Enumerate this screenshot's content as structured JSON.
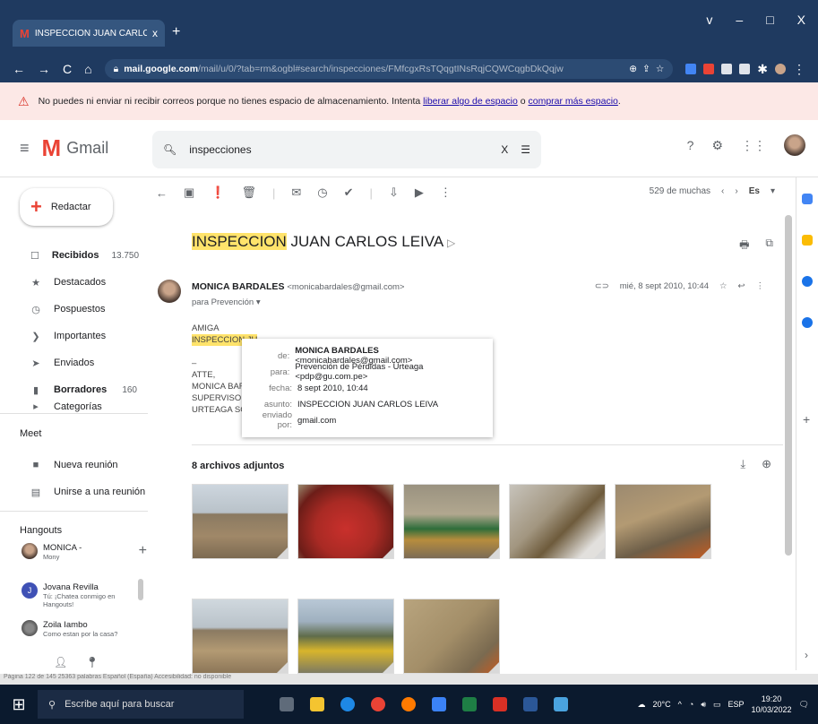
{
  "browser": {
    "tab_title": "INSPECCION JUAN CARLOS LEIV",
    "tab_close": "x",
    "new_tab": "+",
    "url_domain": "mail.google.com",
    "url_path": "/mail/u/0/?tab=rm&ogbl#search/inspecciones/FMfcgxRsTQqgtINsRqjCQWCqgbDkQqjw",
    "window_controls": [
      "v",
      "–",
      "□",
      "X"
    ]
  },
  "warning": {
    "text": "No puedes ni enviar ni recibir correos porque no tienes espacio de almacenamiento. Intenta ",
    "link1": "liberar algo de espacio",
    "mid": " o ",
    "link2": "comprar más espacio",
    "end": "."
  },
  "gmail": {
    "logo_text": "Gmail",
    "search_value": "inspecciones"
  },
  "sidebar": {
    "compose": "Redactar",
    "items": [
      {
        "label": "Recibidos",
        "count": "13.750",
        "icon": "inbox-icon",
        "bold": true
      },
      {
        "label": "Destacados",
        "count": "",
        "icon": "star-icon",
        "bold": false
      },
      {
        "label": "Pospuestos",
        "count": "",
        "icon": "clock-icon",
        "bold": false
      },
      {
        "label": "Importantes",
        "count": "",
        "icon": "important-icon",
        "bold": false
      },
      {
        "label": "Enviados",
        "count": "",
        "icon": "send-icon",
        "bold": false
      },
      {
        "label": "Borradores",
        "count": "160",
        "icon": "draft-icon",
        "bold": true
      },
      {
        "label": "Categorías",
        "count": "",
        "icon": "category-icon",
        "bold": false
      }
    ],
    "meet_title": "Meet",
    "meet_items": [
      "Nueva reunión",
      "Unirse a una reunión"
    ],
    "hangouts_title": "Hangouts",
    "contacts": [
      {
        "name": "MONICA -",
        "sub": "Mony"
      },
      {
        "name": "Jovana Revilla",
        "sub": "Tú: ¡Chatea conmigo en Hangouts!"
      },
      {
        "name": "Zoila Iambo",
        "sub": "Como estan por la casa?"
      }
    ]
  },
  "toolbar": {
    "pager": "529 de muchas",
    "lang": "Es"
  },
  "email": {
    "subject_hl": "INSPECCION",
    "subject_rest": " JUAN CARLOS LEIVA",
    "sender_name": "MONICA BARDALES",
    "sender_email": "<monicabardales@gmail.com>",
    "to_line": "para Prevención",
    "date": "mié, 8 sept 2010, 10:44",
    "body_lines": [
      "AMIGA",
      "INSPECCION JU",
      "",
      "–",
      "ATTE,",
      "MONICA BARD/",
      "SUPERVISORA",
      "URTEAGA SG"
    ],
    "attachments_title": "8 archivos adjuntos"
  },
  "details_popup": [
    {
      "key": "de:",
      "value_bold": "MONICA BARDALES",
      "value": " <monicabardales@gmail.com>"
    },
    {
      "key": "para:",
      "value_bold": "",
      "value": "Prevención de Pérdidas - Urteaga <pdp@gu.com.pe>"
    },
    {
      "key": "fecha:",
      "value_bold": "",
      "value": "8 sept 2010, 10:44"
    },
    {
      "key": "asunto:",
      "value_bold": "",
      "value": "INSPECCION JUAN CARLOS LEIVA"
    },
    {
      "key": "enviado por:",
      "value_bold": "",
      "value": "gmail.com"
    }
  ],
  "word_status": "Página 122 de 145    25363 palabras    Español (España)    Accesibilidad: no disponible",
  "taskbar": {
    "search_placeholder": "Escribe aquí para buscar",
    "temp": "20°C",
    "lang": "ESP",
    "time": "19:20",
    "date": "10/03/2022"
  }
}
